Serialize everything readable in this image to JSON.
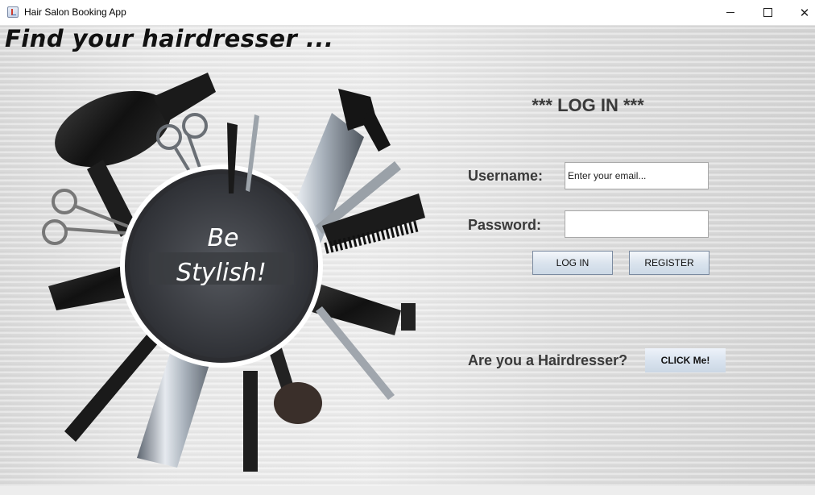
{
  "window": {
    "title": "Hair Salon Booking App",
    "minimize_icon": "minimize-icon",
    "maximize_icon": "maximize-icon",
    "close_glyph": "✕"
  },
  "headline": "Find your hairdresser ...",
  "illustration": {
    "badge_line1": "Be",
    "badge_line2": "Stylish!"
  },
  "login": {
    "title": "*** LOG IN ***",
    "username_label": "Username:",
    "username_placeholder": "Enter your email...",
    "username_value": "",
    "password_label": "Password:",
    "password_value": "",
    "login_button": "LOG IN",
    "register_button": "REGISTER"
  },
  "hairdresser": {
    "prompt": "Are you a Hairdresser?",
    "button": "CLICK Me!"
  }
}
